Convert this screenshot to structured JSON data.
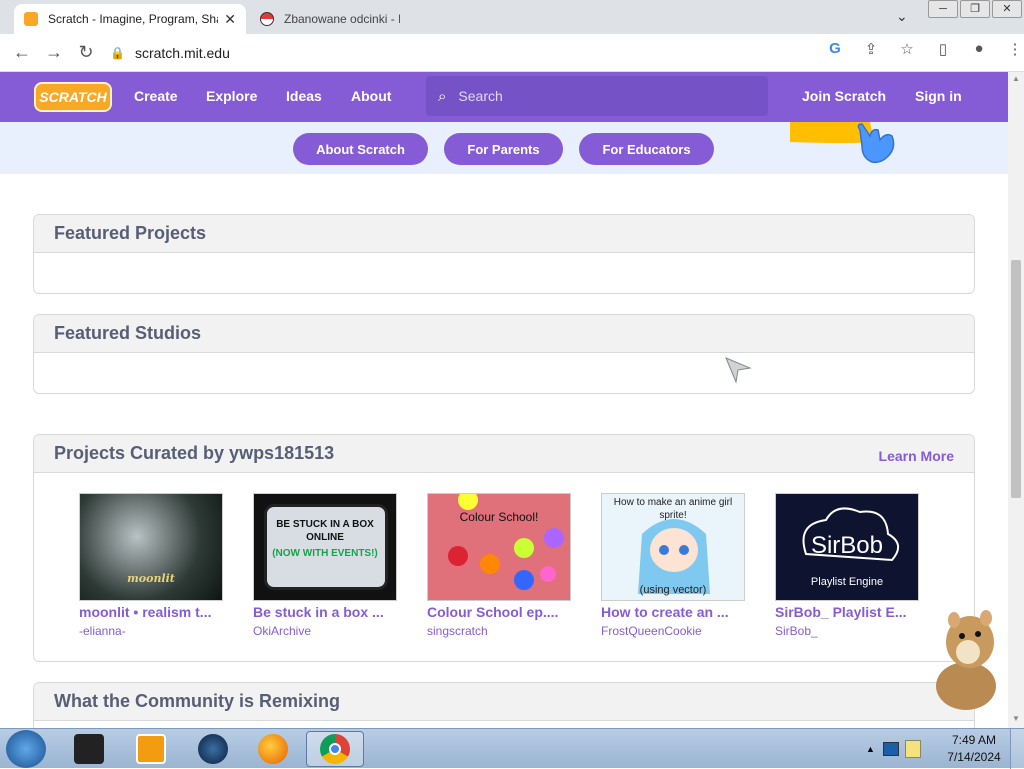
{
  "browser": {
    "tabs": [
      {
        "title": "Scratch - Imagine, Program, Share",
        "close": "✕"
      },
      {
        "title": "Zbanowane odcinki - Pokes"
      }
    ],
    "url": "scratch.mit.edu",
    "window_controls": [
      "─",
      "❐",
      "✕"
    ]
  },
  "nav": {
    "logo": "SCRATCH",
    "links": [
      "Create",
      "Explore",
      "Ideas",
      "About"
    ],
    "search_placeholder": "Search",
    "join": "Join Scratch",
    "signin": "Sign in"
  },
  "hero": {
    "buttons": [
      "About Scratch",
      "For Parents",
      "For Educators"
    ]
  },
  "sections": {
    "featured_projects": "Featured Projects",
    "featured_studios": "Featured Studios",
    "curated": {
      "title": "Projects Curated by ywps181513",
      "learn_more": "Learn More",
      "projects": [
        {
          "title": "moonlit • realism t...",
          "author": "-elianna-",
          "thumb_text": "moonlit"
        },
        {
          "title": "Be stuck in a box ...",
          "author": "OkiArchive",
          "thumb_text": "BE STUCK IN A BOX ONLINE",
          "thumb_text2": "(NOW WITH EVENTS!)"
        },
        {
          "title": "Colour School ep....",
          "author": "singscratch",
          "thumb_text": "Colour School!"
        },
        {
          "title": "How to create an ...",
          "author": "FrostQueenCookie",
          "thumb_text": "How to make an anime girl sprite!",
          "thumb_text2": "(using vector)"
        },
        {
          "title": "SirBob_ Playlist E...",
          "author": "SirBob_",
          "thumb_text": "SirBob",
          "thumb_text2": "Playlist Engine"
        }
      ]
    },
    "remixing": "What the Community is Remixing"
  },
  "taskbar": {
    "time": "7:49 AM",
    "date": "7/14/2024"
  },
  "colors": {
    "scratch_purple": "#855cd6",
    "hero_bg": "#e9f0fd"
  }
}
